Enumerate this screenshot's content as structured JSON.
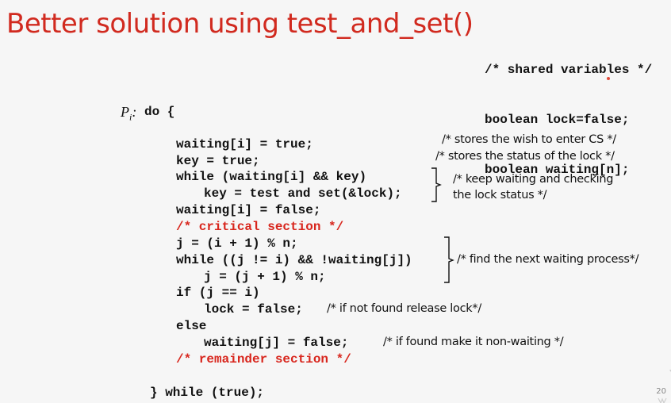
{
  "title": "Better solution using test_and_set()",
  "shared": {
    "comment": "/* shared variables */",
    "lock_decl": "boolean lock=false;",
    "waiting_decl": "boolean waiting[n];"
  },
  "process": {
    "label_p": "P",
    "label_sub": "i",
    "label_colon": ":",
    "do_open": "do {",
    "lines": [
      "waiting[i] = true;",
      "key = true;",
      "while (waiting[i] && key)",
      "key = test and set(&lock);",
      "waiting[i] = false;",
      "/* critical section */",
      "j = (i + 1) % n;",
      "while ((j != i) && !waiting[j])",
      "j = (j + 1) % n;",
      "if (j == i)",
      "lock = false;",
      "else",
      "waiting[j] = false;",
      "/* remainder section */"
    ],
    "do_close": "} while (true);"
  },
  "comments": {
    "wish": "/* stores the wish to enter CS */",
    "status": "/* stores the status of the lock */",
    "keep_waiting_1": "/* keep waiting and checking",
    "keep_waiting_2": "the lock status */",
    "find_next": "/* find the next waiting process*/",
    "not_found": "/* if not found release lock*/",
    "found": "/* if found make it non-waiting */"
  },
  "page_number": "20",
  "colors": {
    "title": "#d12a1f",
    "keyword_comment": "#d8261d",
    "background": "#f6f6f6"
  }
}
